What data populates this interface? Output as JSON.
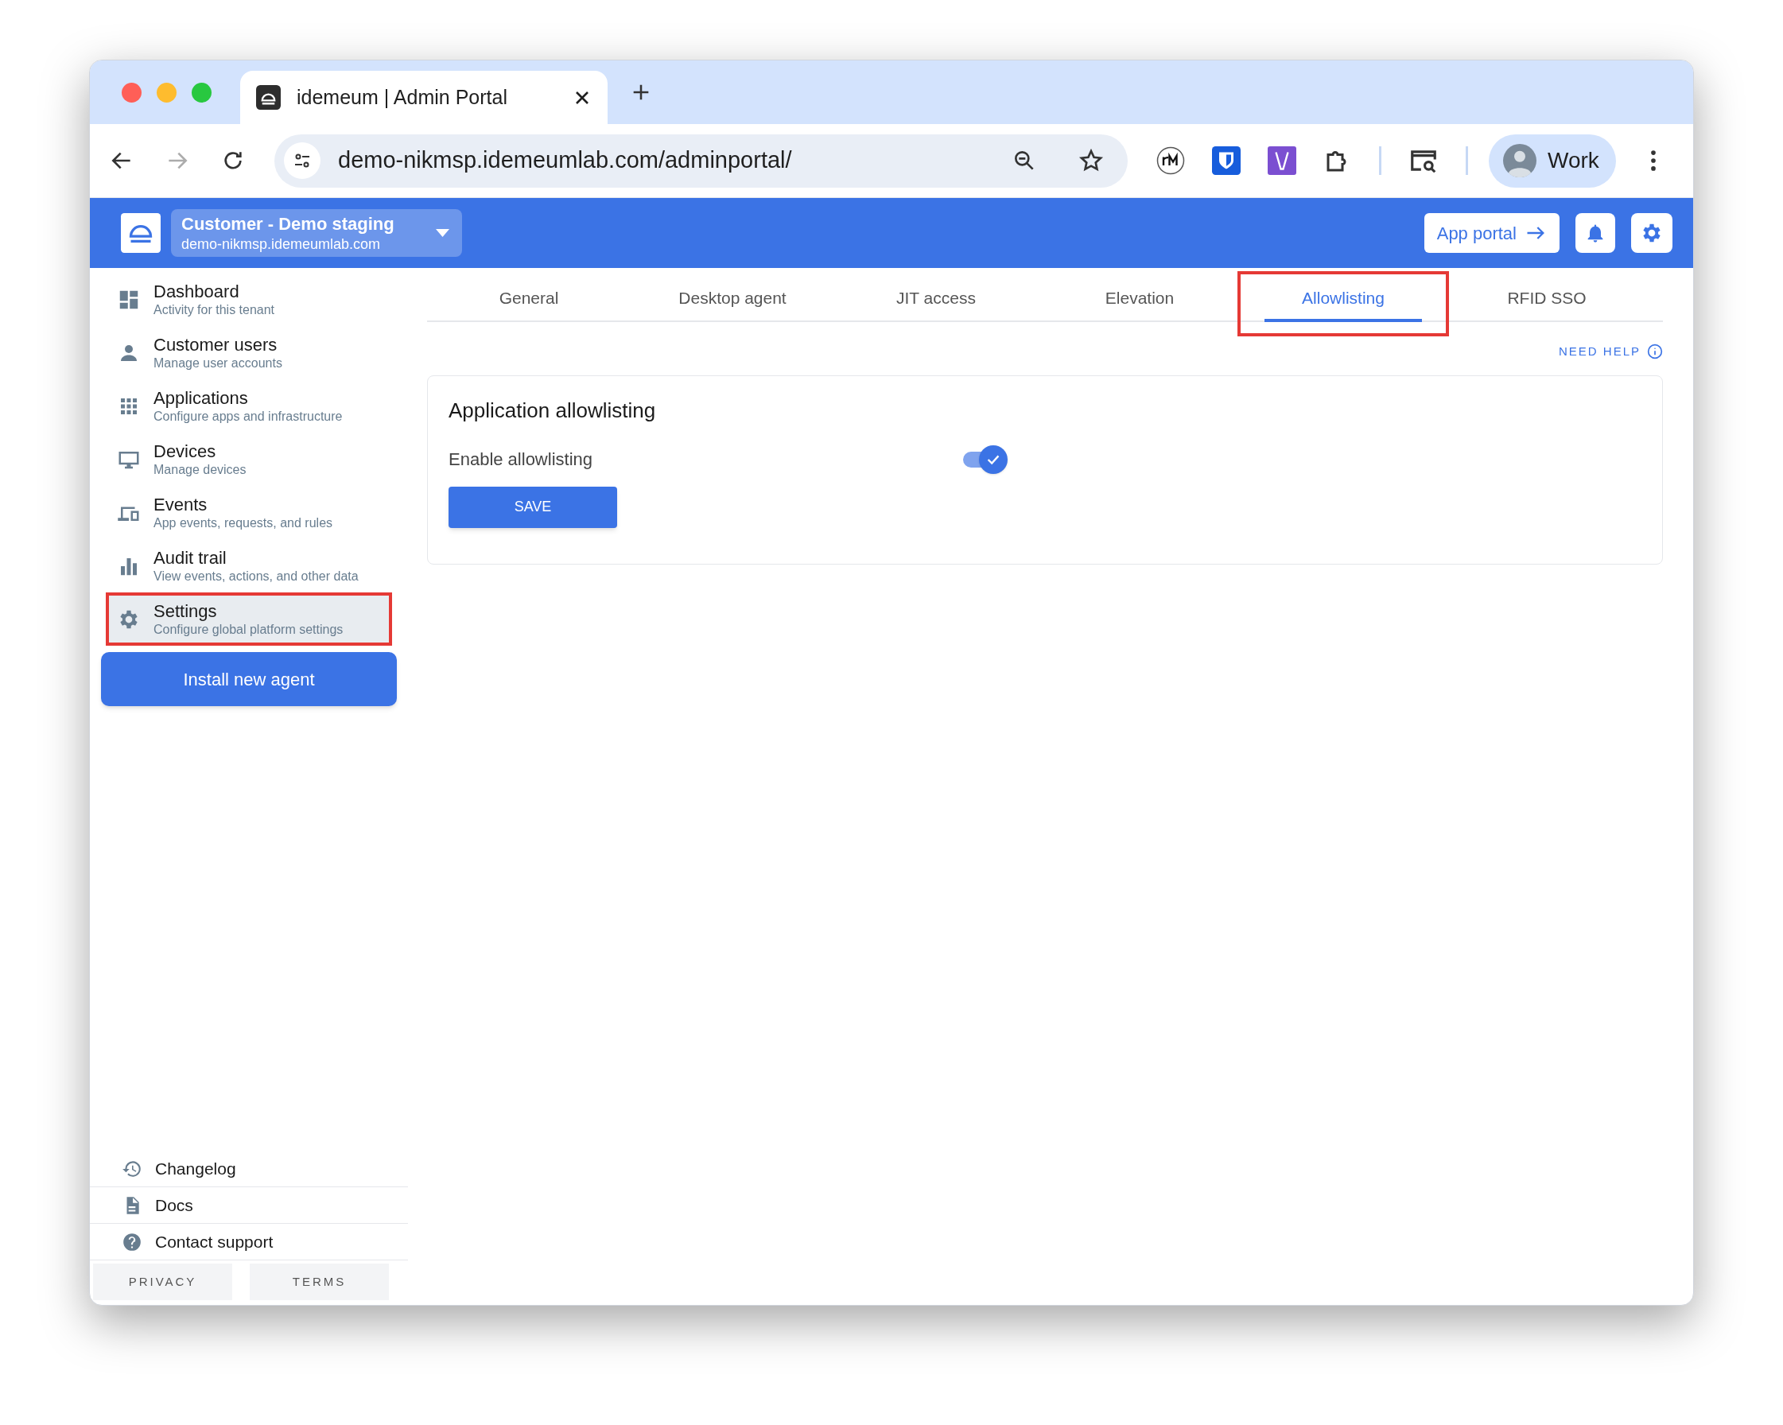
{
  "browser": {
    "tab_title": "idemeum | Admin Portal",
    "address": "demo-nikmsp.idemeumlab.com/adminportal/",
    "profile": "Work"
  },
  "header": {
    "tenant_name": "Customer - Demo staging",
    "tenant_domain": "demo-nikmsp.idemeumlab.com",
    "app_portal": "App portal"
  },
  "sidebar": {
    "items": [
      {
        "title": "Dashboard",
        "subtitle": "Activity for this tenant",
        "selected": false,
        "highlighted": false
      },
      {
        "title": "Customer users",
        "subtitle": "Manage user accounts",
        "selected": false,
        "highlighted": false
      },
      {
        "title": "Applications",
        "subtitle": "Configure apps and infrastructure",
        "selected": false,
        "highlighted": false
      },
      {
        "title": "Devices",
        "subtitle": "Manage devices",
        "selected": false,
        "highlighted": false
      },
      {
        "title": "Events",
        "subtitle": "App events, requests, and rules",
        "selected": false,
        "highlighted": false
      },
      {
        "title": "Audit trail",
        "subtitle": "View events, actions, and other data",
        "selected": false,
        "highlighted": false
      },
      {
        "title": "Settings",
        "subtitle": "Configure global platform settings",
        "selected": true,
        "highlighted": true
      }
    ],
    "install_button": "Install new agent",
    "links": [
      {
        "label": "Changelog"
      },
      {
        "label": "Docs"
      },
      {
        "label": "Contact support"
      }
    ],
    "footer": [
      "PRIVACY",
      "TERMS"
    ]
  },
  "tabs": [
    {
      "label": "General",
      "selected": false,
      "highlighted": false
    },
    {
      "label": "Desktop agent",
      "selected": false,
      "highlighted": false
    },
    {
      "label": "JIT access",
      "selected": false,
      "highlighted": false
    },
    {
      "label": "Elevation",
      "selected": false,
      "highlighted": false
    },
    {
      "label": "Allowlisting",
      "selected": true,
      "highlighted": true
    },
    {
      "label": "RFID SSO",
      "selected": false,
      "highlighted": false
    }
  ],
  "need_help": "NEED HELP",
  "card": {
    "title": "Application allowlisting",
    "toggle_label": "Enable allowlisting",
    "toggle_on": true,
    "save": "SAVE"
  }
}
